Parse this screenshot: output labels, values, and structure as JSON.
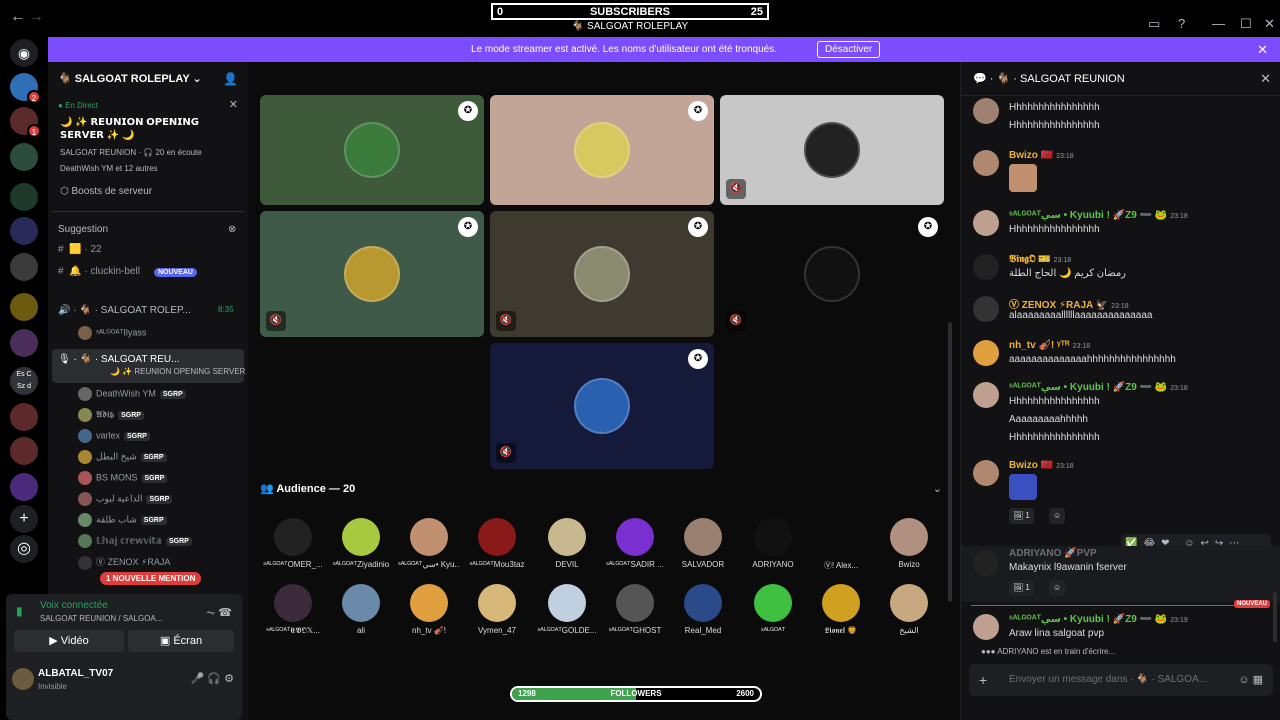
{
  "overlay": {
    "subscribers_min": "0",
    "subscribers_label": "SUBSCRIBERS",
    "subscribers_max": "25",
    "server_label": "SALGOAT ROLEPLAY",
    "followers_min": "1298",
    "followers_label": "FOLLOWERS",
    "followers_max": "2600",
    "followers_progress": 0.5
  },
  "banner": {
    "text": "Le mode streamer est activé. Les noms d'utilisateur ont été tronqués.",
    "button": "Désactiver"
  },
  "guilds": {
    "badges": [
      "2",
      "1"
    ],
    "items": [
      "Es C",
      "Sz d"
    ]
  },
  "sidebar": {
    "server_name": "SALGOAT ROLEPLAY",
    "event": {
      "live_label": "En Direct",
      "title": "🌙 ✨ 𝗥𝗘𝗨𝗡𝗜𝗢𝗡 𝗢𝗣𝗘𝗡𝗜𝗡𝗚 𝗦𝗘𝗥𝗩𝗘𝗥 ✨ 🌙",
      "meta": "SALGOAT REUNION · 🎧 20 en écoute",
      "users": "DeathWish YM et 12 autres"
    },
    "boost": "Boosts de serveur",
    "suggestion": "Suggestion",
    "channels": [
      {
        "name": "🟨 · 22"
      },
      {
        "name": "🔔 · cluckin-bell",
        "badge": "NOUVEAU"
      }
    ],
    "voice1": {
      "name": "· 🐐 · SALGOAT ROLEP...",
      "time": "8:35"
    },
    "voice1_member": "ˢᴬᴸᴳᴼᴬᵀIlyass",
    "voice2": {
      "name": "· 🐐 · SALGOAT REU...",
      "sub": "🌙 ✨ REUNION OPENING SERVER ✨ 🌙"
    },
    "members": [
      {
        "name": "DeathWish YM",
        "tag": "SGRP"
      },
      {
        "name": "𝕬𝖉𝖎𝖇",
        "tag": "SGRP"
      },
      {
        "name": "varlex",
        "tag": "SGRP"
      },
      {
        "name": "شيخ البطل",
        "tag": "SGRP"
      },
      {
        "name": "BS MONS",
        "tag": "SGRP"
      },
      {
        "name": "الداعية لبوب",
        "tag": "SGRP"
      },
      {
        "name": "شاب طلقة",
        "tag": "SGRP"
      },
      {
        "name": "𝕃𝕙𝕒𝕛 𝕔𝕣𝕖𝕨𝕧𝕚𝕥𝕒",
        "tag": "SGRP"
      },
      {
        "name": "Ⓥ ZENOX ⚡RAJA",
        "tag": ""
      }
    ],
    "new_mention": "1 NOUVELLE MENTION",
    "voice_panel": {
      "status": "Voix connectée",
      "channel": "SALGOAT REUNION / SALGOA...",
      "video": "Vidéo",
      "screen": "Écran"
    },
    "user": {
      "name": "ALBATAL_TV07",
      "status": "Invisible"
    }
  },
  "stage": {
    "audience_label": "Audience — 20",
    "audience": [
      "ˢᴬᴸᴳᴼᴬᵀOMER_...",
      "ˢᴬᴸᴳᴼᴬᵀZiyadinio",
      "ˢᴬᴸᴳᴼᴬᵀسي• Kyu...",
      "ˢᴬᴸᴳᴼᴬᵀMou3taz",
      "DEVIL",
      "ˢᴬᴸᴳᴼᴬᵀSADIR ...",
      "SALVADOR",
      "ADRIYANO",
      "Ⓥ! Alex...",
      "Bwizo",
      "ˢᴬᴸᴳᴼᴬᵀ𝕰𝖁𝕺𝕏...",
      "ali",
      "nh_tv 🎻!",
      "Vymen_47",
      "ˢᴬᴸᴳᴼᴬᵀGOLDE...",
      "ˢᴬᴸᴳᴼᴬᵀGHOST",
      "Real_Med",
      "ˢᴬᴸᴳᴼᴬᵀ",
      "𝕷𝖎𝖔𝖓𝖊𝖑 🦁",
      "الشيخ"
    ]
  },
  "chat": {
    "title": "SALGOAT REUNION",
    "messages": [
      {
        "name": "",
        "time": "",
        "lines": [
          "Hhhhhhhhhhhhhhhh",
          "Hhhhhhhhhhhhhhhh"
        ]
      },
      {
        "name": "Bwizo 🇲🇦",
        "time": "23:18",
        "lines": []
      },
      {
        "name": "ˢᴬᴸᴳᴼᴬᵀسي • Kyuubi ! 🚀Z9 ➖ 🐸",
        "time": "23:18",
        "lines": [
          "Hhhhhhhhhhhhhhhh"
        ]
      },
      {
        "name": "𝕭𝖎𝖓𝖌𝕺 🎫",
        "time": "23:18",
        "lines": [
          "رمضان كريم 🌙 الحاج الطلة"
        ]
      },
      {
        "name": "Ⓥ ZENOX ⚡RAJA 🦅",
        "time": "23:18",
        "lines": [
          "alaaaaaaaallllllaaaaaaaaaaaaaa"
        ]
      },
      {
        "name": "nh_tv 🎻! ᵞᵀᴿ",
        "time": "23:18",
        "lines": [
          "aaaaaaaaaaaaaahhhhhhhhhhhhhhhh"
        ]
      },
      {
        "name": "ˢᴬᴸᴳᴼᴬᵀسي • Kyuubi ! 🚀Z9 ➖ 🐸",
        "time": "23:18",
        "lines": [
          "Hhhhhhhhhhhhhhhh",
          "Aaaaaaaaahhhhh",
          "Hhhhhhhhhhhhhhhh"
        ]
      },
      {
        "name": "Bwizo 🇲🇦",
        "time": "23:18",
        "lines": [],
        "reaction": "1"
      },
      {
        "name": "ADRIYANO 🚀PVP",
        "time": "",
        "lines": [
          "Makaynix l9awanin fserver"
        ],
        "reaction": "1"
      },
      {
        "name": "ˢᴬᴸᴳᴼᴬᵀسي • Kyuubi ! 🚀Z9 ➖ 🐸",
        "time": "23:19",
        "lines": [
          "Araw lina salgoat pvp"
        ]
      }
    ],
    "new_label": "NOUVEAU",
    "typing": "ADRIYANO est en train d'écrire...",
    "placeholder": "Envoyer un message dans · 🐐 · SALGOA..."
  }
}
